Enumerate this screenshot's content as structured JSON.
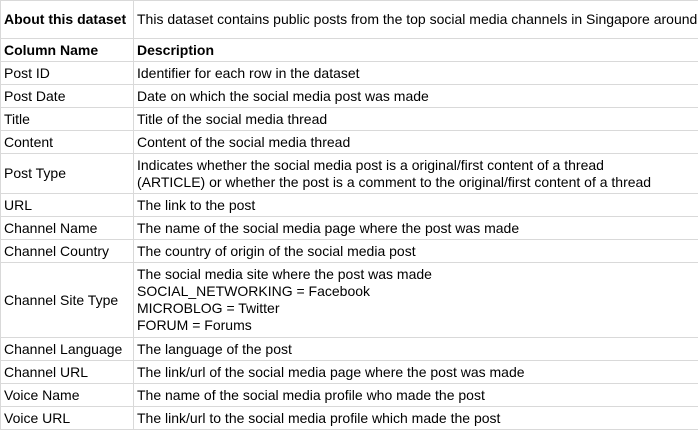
{
  "about": {
    "label": "About this dataset",
    "text": "This dataset contains public posts from the top social media channels in Singapore around juices & beverages"
  },
  "header": {
    "col1": "Column Name",
    "col2": "Description"
  },
  "rows": [
    {
      "name": "Post ID",
      "lines": [
        "Identifier for each row in the dataset"
      ]
    },
    {
      "name": "Post Date",
      "lines": [
        "Date on which the social media post was made"
      ]
    },
    {
      "name": "Title",
      "lines": [
        "Title of the social media thread"
      ]
    },
    {
      "name": "Content",
      "lines": [
        "Content of the social media thread"
      ]
    },
    {
      "name": "Post Type",
      "lines": [
        "Indicates whether the social media post is a original/first content of a thread",
        "(ARTICLE) or whether the post is a comment to the original/first content of a thread"
      ]
    },
    {
      "name": "URL",
      "lines": [
        "The link to the post"
      ]
    },
    {
      "name": "Channel Name",
      "lines": [
        "The name of the social media page where the post was made"
      ]
    },
    {
      "name": "Channel Country",
      "lines": [
        "The country of origin of the social media post"
      ]
    },
    {
      "name": "Channel Site Type",
      "lines": [
        "The social media site where the post was made",
        "SOCIAL_NETWORKING = Facebook",
        "MICROBLOG = Twitter",
        "FORUM = Forums"
      ]
    },
    {
      "name": "Channel Language",
      "lines": [
        "The language of the post"
      ]
    },
    {
      "name": "Channel URL",
      "lines": [
        "The link/url of the social media page where the post was made"
      ]
    },
    {
      "name": "Voice Name",
      "lines": [
        "The name of the social media profile who made the post"
      ]
    },
    {
      "name": "Voice URL",
      "lines": [
        "The link/url to the social media profile which made the post"
      ]
    }
  ]
}
